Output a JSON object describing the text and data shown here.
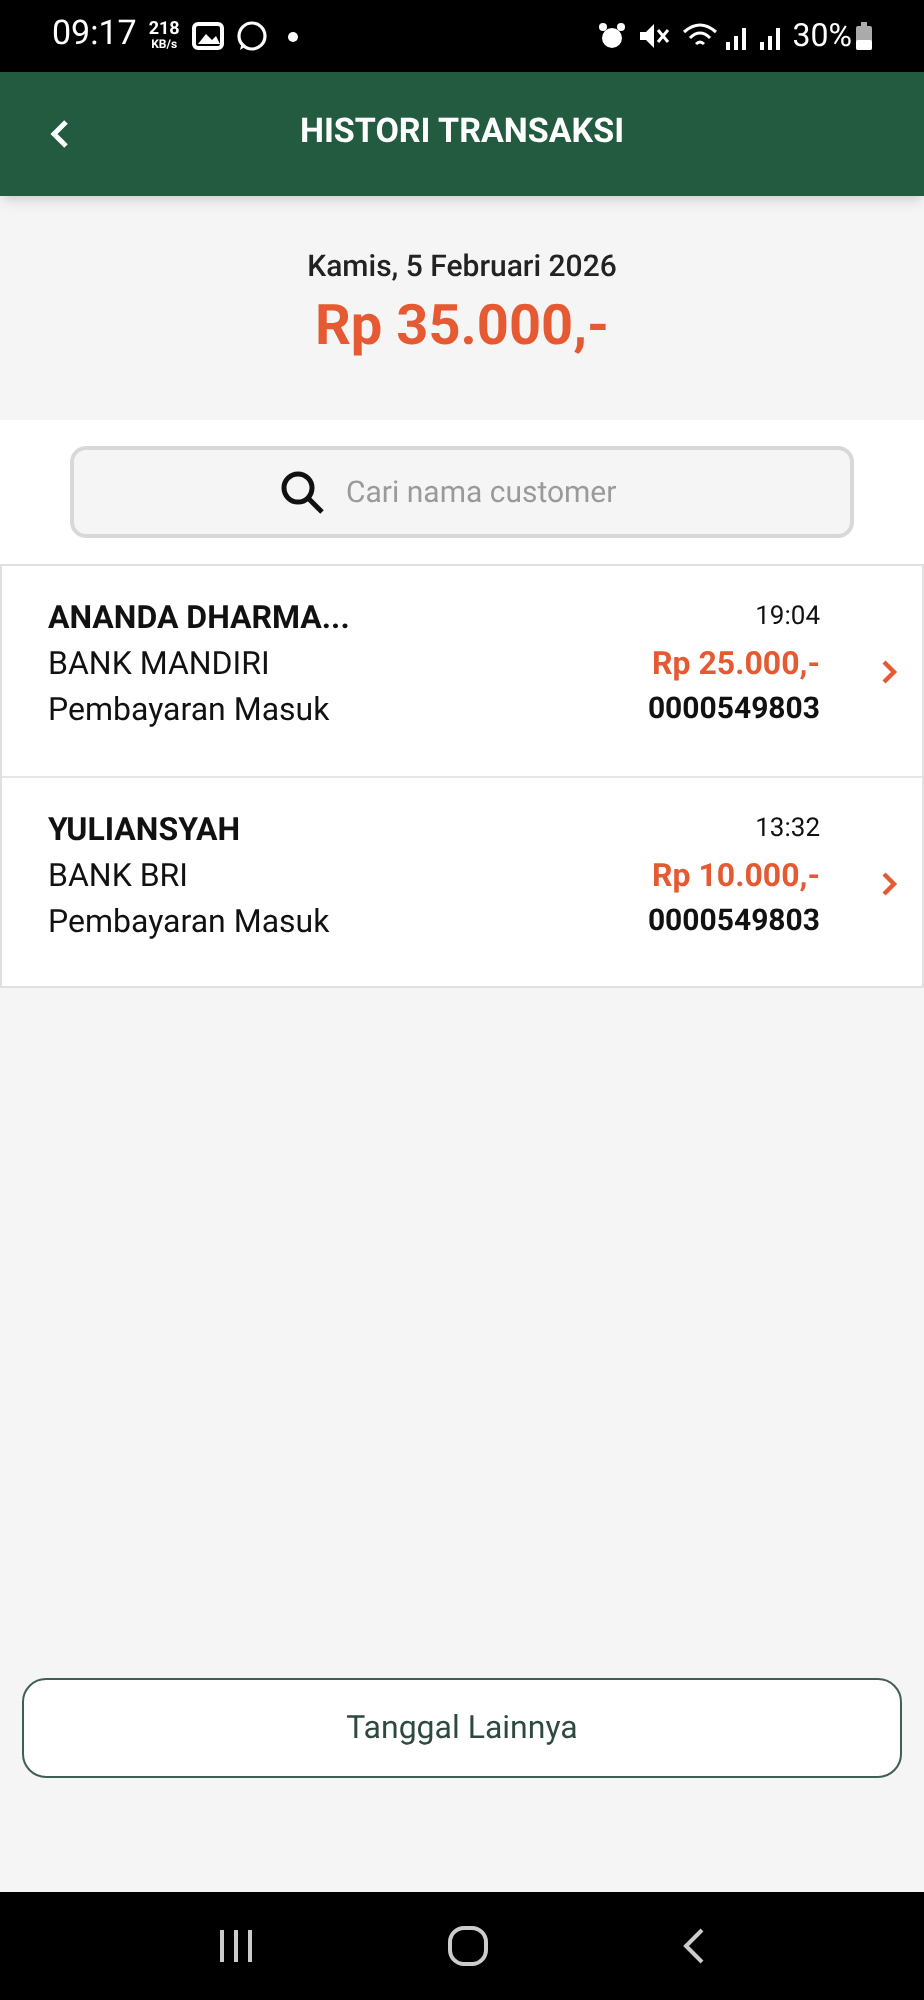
{
  "status_bar": {
    "time": "09:17",
    "speed": "218",
    "speed_unit": "KB/s",
    "battery": "30%"
  },
  "header": {
    "title": "HISTORI TRANSAKSI"
  },
  "summary": {
    "date": "Kamis, 5 Februari 2026",
    "total": "Rp 35.000,-"
  },
  "search": {
    "placeholder": "Cari nama customer"
  },
  "transactions": [
    {
      "name": "ANANDA DHARMA...",
      "bank": "BANK MANDIRI",
      "type": "Pembayaran Masuk",
      "time": "19:04",
      "amount": "Rp 25.000,-",
      "reference": "0000549803"
    },
    {
      "name": "YULIANSYAH",
      "bank": "BANK BRI",
      "type": "Pembayaran Masuk",
      "time": "13:32",
      "amount": "Rp 10.000,-",
      "reference": "0000549803"
    }
  ],
  "more_button": "Tanggal Lainnya"
}
